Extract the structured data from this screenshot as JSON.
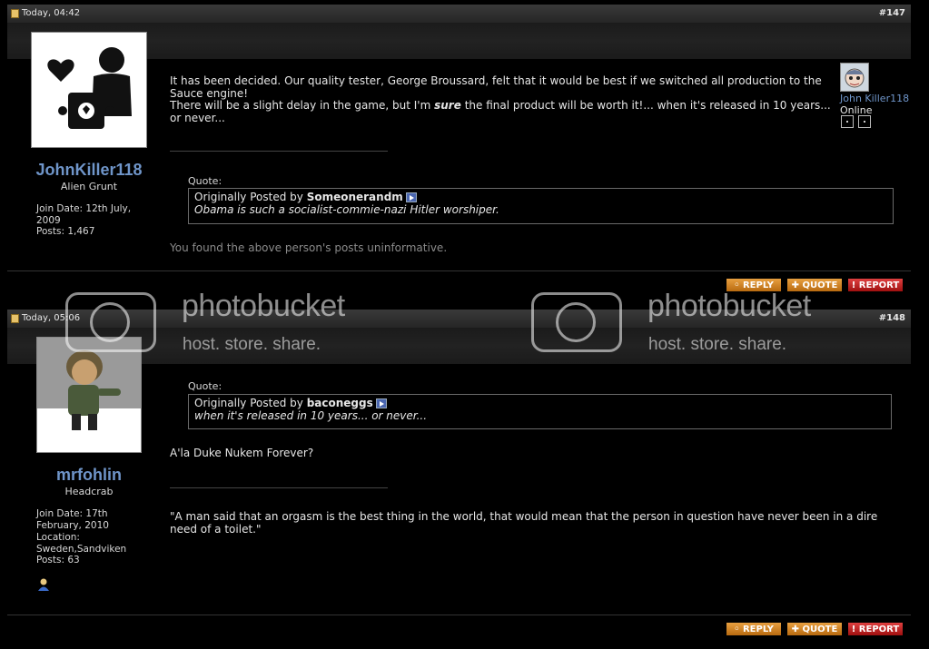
{
  "posts": [
    {
      "date": "Today, 04:42",
      "number": "#147",
      "username": "JohnKiller118",
      "rank": "Alien Grunt",
      "join_date": "Join Date: 12th July, 2009",
      "posts_count": "Posts: 1,467",
      "body_lines": [
        "It has been decided. Our quality tester, George Broussard, felt that it would be best if we switched all production to the Sauce engine!",
        "There will be a slight delay in the game, but I'm",
        "sure",
        "the final product will be worth it!... when it's released in 10 years... or never..."
      ],
      "sig_quote_label": "Quote:",
      "sig_quote_prefix": "Originally Posted by",
      "sig_quote_poster": "Someonerandm",
      "sig_quote_text": "Obama is such a socialist-commie-nazi Hitler worshiper.",
      "feedback": "You found the above person's posts uninformative.",
      "side_user": "John Killer118",
      "side_status": "Online",
      "buttons": {
        "reply": "REPLY",
        "quote": "QUOTE",
        "report": "REPORT"
      }
    },
    {
      "date": "Today, 05:06",
      "number": "#148",
      "username": "mrfohlin",
      "rank": "Headcrab",
      "join_date": "Join Date: 17th February, 2010",
      "location": "Location: Sweden,Sandviken",
      "posts_count": "Posts: 63",
      "quote_label": "Quote:",
      "quote_prefix": "Originally Posted by",
      "quote_poster": "baconeggs",
      "quote_text": "when it's released in 10 years... or never...",
      "body": "A'la Duke Nukem Forever?",
      "signature": "\"A man said that an orgasm is the best thing in the world, that would mean that the person in question have never been in a dire need of a toilet.\"",
      "buttons": {
        "reply": "REPLY",
        "quote": "QUOTE",
        "report": "REPORT"
      }
    }
  ],
  "watermark": {
    "title": "photobucket",
    "subtitle": "host. store. share."
  }
}
